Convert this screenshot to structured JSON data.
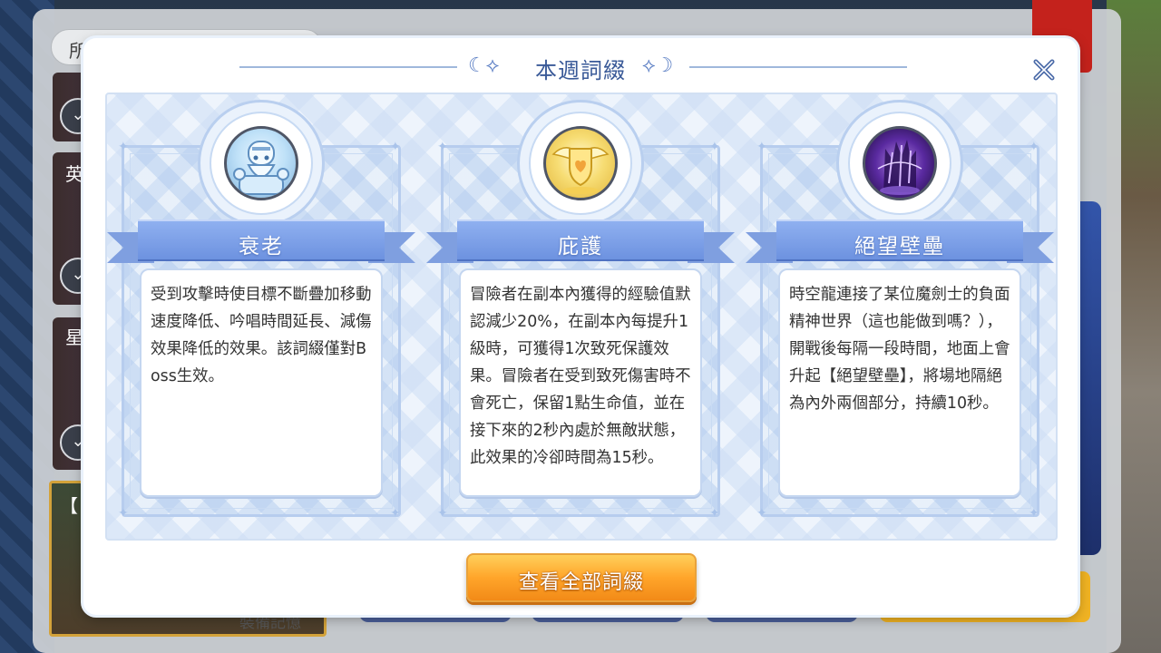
{
  "background": {
    "search_text": "所",
    "cards": [
      {
        "label": "英"
      },
      {
        "label": "星"
      }
    ],
    "gold_card_title": "【 滄",
    "bottom_text": "裝備記憶"
  },
  "modal": {
    "title": "本週詞綴",
    "ornament_left": "☾⟡",
    "ornament_right": "⟡☽",
    "close_icon": "close-icon",
    "cards": [
      {
        "name": "衰老",
        "icon": "knight-elder-icon",
        "description": "受到攻擊時使目標不斷疊加移動速度降低、吟唱時間延長、減傷效果降低的效果。該詞綴僅對Boss生效。"
      },
      {
        "name": "庇護",
        "icon": "winged-shield-icon",
        "description": "冒險者在副本內獲得的經驗值默認減少20%，在副本內每提升1級時，可獲得1次致死保護效果。冒險者在受到致死傷害時不會死亡，保留1點生命值，並在接下來的2秒內處於無敵狀態，此效果的冷卻時間為15秒。"
      },
      {
        "name": "絕望壁壘",
        "icon": "despair-barrier-icon",
        "description": "時空龍連接了某位魔劍士的負面精神世界（這也能做到嗎？），開戰後每隔一段時間，地面上會升起【絕望壁壘】，將場地隔絕為內外兩個部分，持續10秒。"
      }
    ],
    "view_all_label": "查看全部詞綴"
  },
  "colors": {
    "title": "#3a5a98",
    "ribbon": "#6d92e0",
    "button": "#ffa52a"
  }
}
